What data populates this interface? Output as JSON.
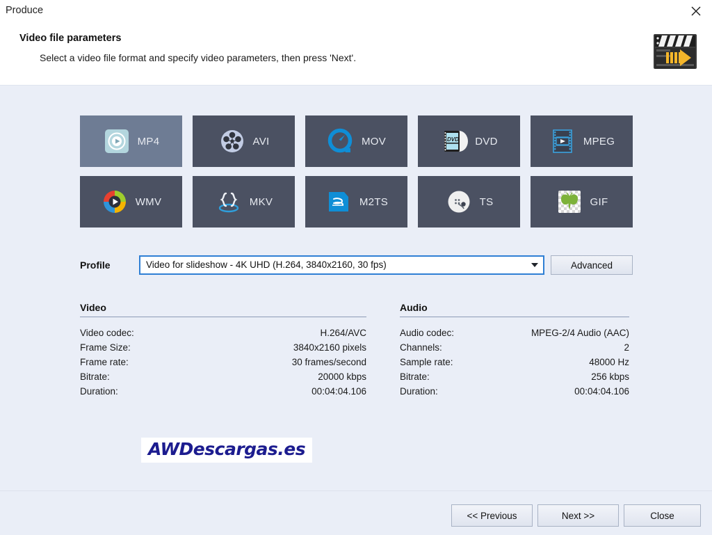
{
  "window": {
    "title": "Produce",
    "close_icon": "close-icon"
  },
  "header": {
    "title": "Video file parameters",
    "subtitle": "Select a video file format and specify video parameters, then press 'Next'.",
    "icon": "clapperboard-icon"
  },
  "formats": [
    {
      "label": "MP4",
      "icon": "mp4-icon",
      "selected": true
    },
    {
      "label": "AVI",
      "icon": "avi-film-reel-icon",
      "selected": false
    },
    {
      "label": "MOV",
      "icon": "quicktime-icon",
      "selected": false
    },
    {
      "label": "DVD",
      "icon": "dvd-disc-icon",
      "selected": false
    },
    {
      "label": "MPEG",
      "icon": "mpeg-filmstrip-icon",
      "selected": false
    },
    {
      "label": "WMV",
      "icon": "wmv-icon",
      "selected": false
    },
    {
      "label": "MKV",
      "icon": "mkv-braces-icon",
      "selected": false
    },
    {
      "label": "M2TS",
      "icon": "bluray-icon",
      "selected": false
    },
    {
      "label": "TS",
      "icon": "ts-satellite-icon",
      "selected": false
    },
    {
      "label": "GIF",
      "icon": "gif-butterfly-icon",
      "selected": false
    }
  ],
  "profile": {
    "label": "Profile",
    "value": "Video for slideshow - 4K UHD (H.264, 3840x2160, 30 fps)",
    "dropdown_icon": "chevron-down-icon",
    "advanced_label": "Advanced"
  },
  "video_panel": {
    "heading": "Video",
    "rows": [
      {
        "label": "Video codec:",
        "value": "H.264/AVC"
      },
      {
        "label": "Frame Size:",
        "value": "3840x2160 pixels"
      },
      {
        "label": "Frame rate:",
        "value": "30 frames/second"
      },
      {
        "label": "Bitrate:",
        "value": "20000 kbps"
      },
      {
        "label": "Duration:",
        "value": "00:04:04.106"
      }
    ]
  },
  "audio_panel": {
    "heading": "Audio",
    "rows": [
      {
        "label": "Audio codec:",
        "value": "MPEG-2/4 Audio (AAC)"
      },
      {
        "label": "Channels:",
        "value": "2"
      },
      {
        "label": "Sample rate:",
        "value": "48000 Hz"
      },
      {
        "label": "Bitrate:",
        "value": "256 kbps"
      },
      {
        "label": "Duration:",
        "value": "00:04:04.106"
      }
    ]
  },
  "watermark": {
    "text": "AWDescargas.es"
  },
  "footer": {
    "previous_label": "<< Previous",
    "next_label": "Next >>",
    "close_label": "Close"
  },
  "colors": {
    "body_bg": "#eaeef7",
    "header_bg": "#ffffff",
    "button_bg": "#4b5162",
    "button_selected_bg": "#6e7c94",
    "accent_blue": "#2f7fd4",
    "icon_cyan": "#0f8ed6",
    "watermark_blue": "#1c1c8f"
  }
}
